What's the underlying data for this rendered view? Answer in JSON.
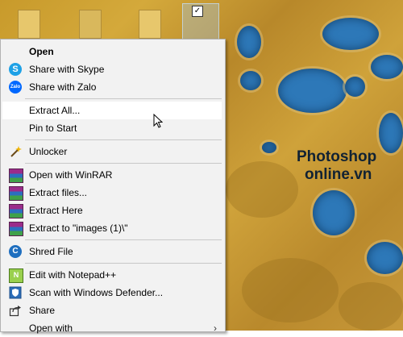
{
  "menu": {
    "items": [
      {
        "label": "Open",
        "bold": true
      },
      {
        "label": "Share with Skype"
      },
      {
        "label": "Share with Zalo"
      },
      {
        "label": "Extract All..."
      },
      {
        "label": "Pin to Start"
      },
      {
        "label": "Unlocker"
      },
      {
        "label": "Open with WinRAR"
      },
      {
        "label": "Extract files..."
      },
      {
        "label": "Extract Here"
      },
      {
        "label": "Extract to \"images (1)\\\""
      },
      {
        "label": "Shred File"
      },
      {
        "label": "Edit with Notepad++"
      },
      {
        "label": "Scan with Windows Defender..."
      },
      {
        "label": "Share"
      },
      {
        "label": "Open with"
      }
    ]
  },
  "icons": {
    "skype_glyph": "S",
    "zalo_glyph": "Zalo",
    "shred_glyph": "C",
    "npp_glyph": "N",
    "chevron": "›",
    "checkbox": "✓"
  },
  "watermark": {
    "line1": "Photoshop",
    "line2": "online.vn"
  },
  "colors": {
    "menu_bg": "#f2f2f2",
    "hover_bg": "#ffffff",
    "brand_green": "#2fbf5a"
  }
}
